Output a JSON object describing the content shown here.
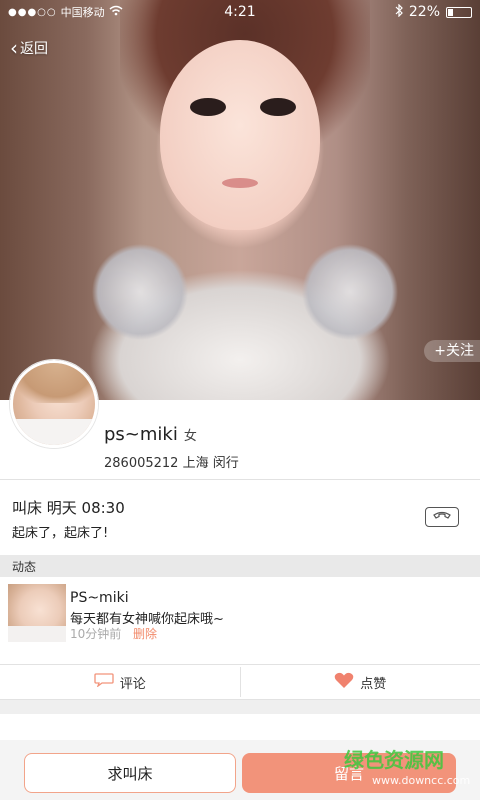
{
  "status_bar": {
    "signal": "●●●○○",
    "carrier": "中国移动",
    "time": "4:21",
    "battery": "22%"
  },
  "nav": {
    "back_label": "返回"
  },
  "hero": {
    "follow_label": "+关注"
  },
  "profile": {
    "name": "ps~miki",
    "gender": "女",
    "id_location": "286005212 上海 闵行"
  },
  "alarm": {
    "title": "叫床  明天 08:30",
    "message": "起床了，起床了!"
  },
  "feed": {
    "section_title": "动态",
    "post": {
      "author": "PS~miki",
      "text": "每天都有女神喊你起床哦~",
      "time": "10分钟前",
      "delete_label": "删除"
    },
    "actions": {
      "comment_label": "评论",
      "like_label": "点赞"
    }
  },
  "bottom_bar": {
    "wake_label": "求叫床",
    "message_label": "留言"
  },
  "watermark": {
    "title": "绿色资源网",
    "url": "www.downcc.com"
  },
  "colors": {
    "accent": "#f2937a",
    "accent_border": "#f2a48a",
    "delete_red": "#f28a6a",
    "like_heart": "#f0826e"
  }
}
